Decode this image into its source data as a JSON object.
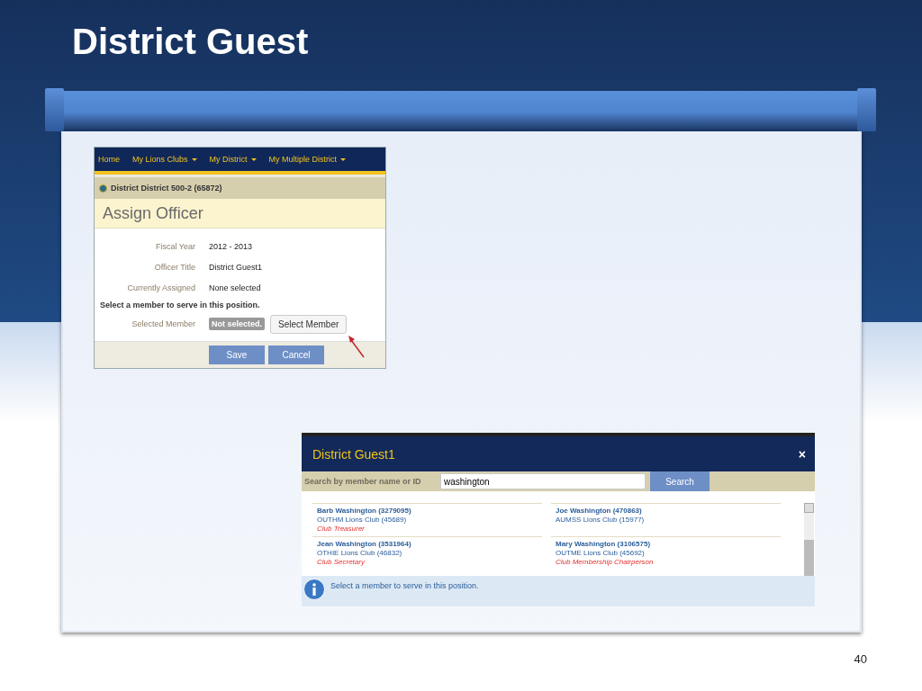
{
  "slide": {
    "title": "District Guest",
    "page_number": "40"
  },
  "screenshot_1": {
    "nav": [
      {
        "label": "Home",
        "dropdown": false
      },
      {
        "label": "My Lions Clubs",
        "dropdown": true
      },
      {
        "label": "My District",
        "dropdown": true
      },
      {
        "label": "My Multiple District",
        "dropdown": true
      }
    ],
    "district_header": "District District 500-2 (65872)",
    "page_title": "Assign Officer",
    "fields": [
      {
        "label": "Fiscal Year",
        "value": "2012 - 2013"
      },
      {
        "label": "Officer Title",
        "value": "District Guest1"
      },
      {
        "label": "Currently Assigned",
        "value": "None selected"
      }
    ],
    "instruction": "Select a member to serve in this position.",
    "selected_member_label": "Selected Member",
    "selected_member_badge": "Not selected.",
    "select_button": "Select Member",
    "buttons": [
      "Save",
      "Cancel"
    ]
  },
  "screenshot_2": {
    "dialog_title": "District Guest1",
    "close": "×",
    "search_label": "Search by member name or ID",
    "search_value": "washington",
    "search_button": "Search",
    "results": [
      {
        "name": "Barb Washington (3279095)",
        "club": "OUTHM Lions Club (45689)",
        "position": "Club Treasurer"
      },
      {
        "name": "Joe Washington (470863)",
        "club": "AUMSS Lions Club (15977)"
      },
      {
        "name": "Jean Washington (3531964)",
        "club": "OTHIE Lions Club (46832)",
        "position": "Club Secretary"
      },
      {
        "name": "Mary Washington (3106575)",
        "club": "OUTME Lions Club (45692)",
        "position": "Club Membership Chairperson"
      }
    ],
    "info_message": "Select a member to serve in this position."
  }
}
